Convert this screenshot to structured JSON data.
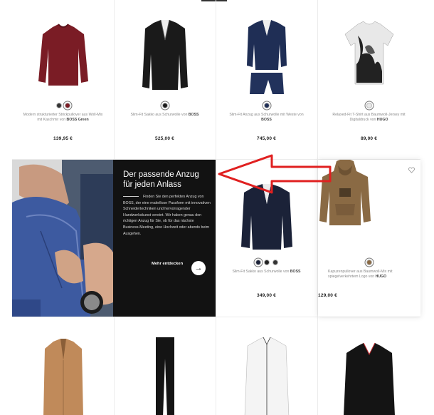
{
  "colors": {
    "accent": "#e02020",
    "promo_bg": "#121212"
  },
  "products": [
    {
      "desc_pre": "Modern strukturierter Strickpullover aus Woll-Mix mit Kaschmir von ",
      "brand": "BOSS Green",
      "price": "139,95 €",
      "icon": "sweater-icon"
    },
    {
      "desc_pre": "Slim-Fit Sakko aus Schurwolle von ",
      "brand": "BOSS",
      "price": "525,00 €",
      "icon": "blazer-icon"
    },
    {
      "desc_pre": "Slim-Fit Anzug aus Schurwolle mit Weste von ",
      "brand": "BOSS",
      "price": "745,00 €",
      "icon": "suit-icon"
    },
    {
      "desc_pre": "Relaxed-Fit T-Shirt aus Baumwoll-Jersey mit Digitaldruck von ",
      "brand": "HUGO",
      "price": "89,00 €",
      "icon": "tshirt-icon"
    },
    {
      "desc_pre": "Slim-Fit Sakko aus Schurwolle von ",
      "brand": "BOSS",
      "price": "349,00 €",
      "icon": "blazer-icon"
    },
    {
      "desc_pre": "Kapuzenpullover aus Baumwoll-Mix mit spiegelverkehrtem Logo von ",
      "brand": "HUGO",
      "price": "129,00 €",
      "icon": "hoodie-icon"
    }
  ],
  "promo": {
    "title": "Der passende Anzug für jeden Anlass",
    "text": "Finden Sie den perfekten Anzug von BOSS, der eine makellose Passform mit innovativen Schneidertechniken und hervorragender Handwerkskunst vereint. Wir haben genau den richtigen Anzug für Sie, ob für das nächste Business-Meeting, eine Hochzeit oder abends beim Ausgehen.",
    "cta": "Mehr entdecken",
    "cta_icon": "arrow-right-icon"
  }
}
